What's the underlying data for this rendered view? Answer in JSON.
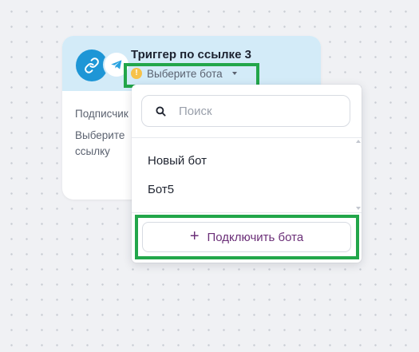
{
  "node": {
    "title": "Триггер по ссылке 3",
    "bot_select_label": "Выберите бота",
    "warning_glyph": "!",
    "body_line1": "Подписчик",
    "body_line2": "Выберите",
    "body_line3": "ссылку",
    "icons": [
      "link-icon",
      "telegram-icon",
      "warning-icon",
      "caret-down-icon"
    ]
  },
  "dropdown": {
    "search_placeholder": "Поиск",
    "bots": [
      {
        "label": "Новый бот"
      },
      {
        "label": "Бот5"
      }
    ],
    "connect_label": "Подключить бота",
    "connect_icon": "+"
  },
  "colors": {
    "header_bg": "#d3ebf8",
    "link_badge": "#1e96d6",
    "telegram": "#2aa3e0",
    "warning": "#f7c24a",
    "accent_purple": "#6b2f78",
    "highlight": "#22a64a",
    "canvas": "#f0f1f4"
  }
}
